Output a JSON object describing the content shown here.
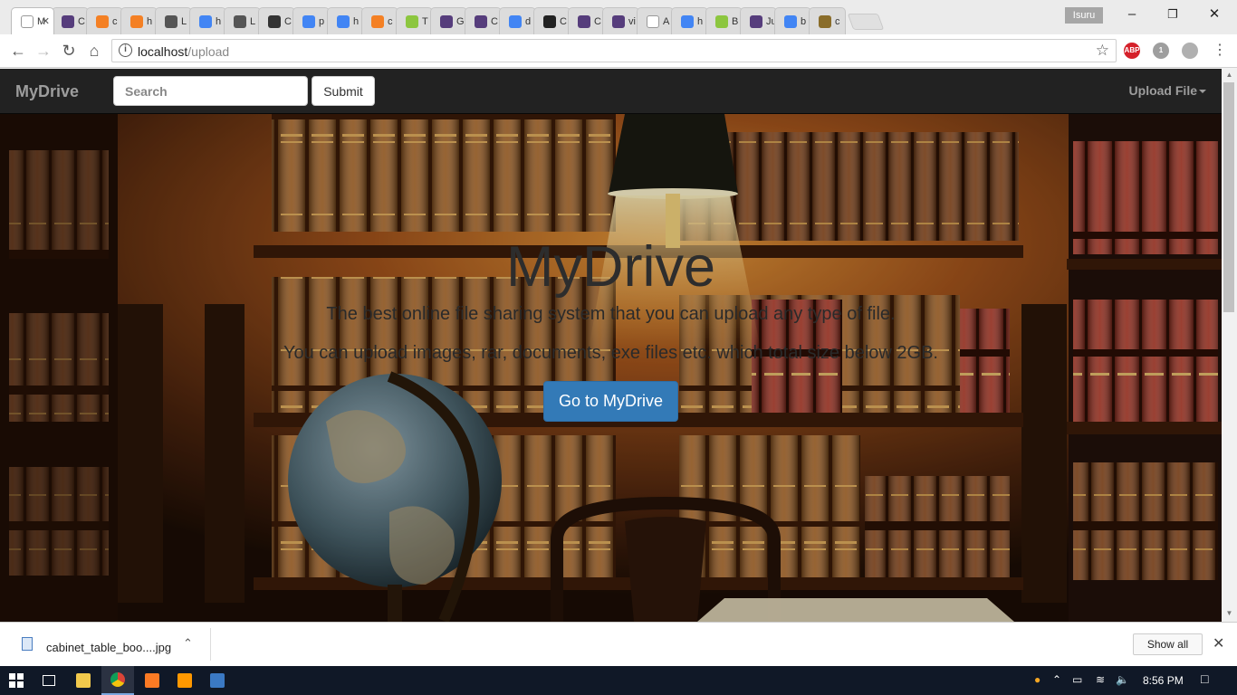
{
  "browser": {
    "tabs": [
      {
        "label": "M",
        "icon": "doc-icon",
        "color": "#ffffff",
        "active": true
      },
      {
        "label": "C",
        "icon": "bootstrap-icon",
        "color": "#563d7c"
      },
      {
        "label": "c",
        "icon": "stackoverflow-icon",
        "color": "#f48024"
      },
      {
        "label": "h",
        "icon": "stackoverflow-icon",
        "color": "#f48024"
      },
      {
        "label": "L",
        "icon": "dark-circle-icon",
        "color": "#555555"
      },
      {
        "label": "h",
        "icon": "google-icon",
        "color": "#4285f4"
      },
      {
        "label": "L",
        "icon": "dark-circle-icon",
        "color": "#555555"
      },
      {
        "label": "C",
        "icon": "play-icon",
        "color": "#333333"
      },
      {
        "label": "p",
        "icon": "google-icon",
        "color": "#4285f4"
      },
      {
        "label": "h",
        "icon": "google-icon",
        "color": "#4285f4"
      },
      {
        "label": "c",
        "icon": "stackoverflow-icon",
        "color": "#f48024"
      },
      {
        "label": "T",
        "icon": "w3schools-icon",
        "color": "#8cc63f"
      },
      {
        "label": "G",
        "icon": "bootstrap-icon",
        "color": "#563d7c"
      },
      {
        "label": "C",
        "icon": "bootstrap-icon",
        "color": "#563d7c"
      },
      {
        "label": "d",
        "icon": "google-icon",
        "color": "#4285f4"
      },
      {
        "label": "C",
        "icon": "w-icon",
        "color": "#222222"
      },
      {
        "label": "C",
        "icon": "bootstrap-icon",
        "color": "#563d7c"
      },
      {
        "label": "vi",
        "icon": "bootstrap-icon",
        "color": "#563d7c"
      },
      {
        "label": "A",
        "icon": "doc-icon",
        "color": "#ffffff"
      },
      {
        "label": "h",
        "icon": "google-icon",
        "color": "#4285f4"
      },
      {
        "label": "B",
        "icon": "w3schools-icon",
        "color": "#8cc63f"
      },
      {
        "label": "Ju",
        "icon": "bootstrap-icon",
        "color": "#563d7c"
      },
      {
        "label": "b",
        "icon": "google-icon",
        "color": "#4285f4"
      },
      {
        "label": "c",
        "icon": "grid-icon",
        "color": "#8a6d2a"
      }
    ],
    "profile_name": "Isuru",
    "url_host": "localhost",
    "url_path": "/upload",
    "extensions": [
      {
        "label": "ABP",
        "icon": "adblock-icon",
        "color": "#d5202a"
      },
      {
        "label": "1",
        "icon": "ghost-icon",
        "color": "#9e9e9e"
      },
      {
        "label": "",
        "icon": "puzzle-icon",
        "color": "#b0b0b0"
      }
    ]
  },
  "page": {
    "brand": "MyDrive",
    "search_placeholder": "Search",
    "submit_label": "Submit",
    "upload_menu": "Upload File",
    "hero_title": "MyDrive",
    "hero_line1": "The best online file sharing system that you can upload any type of file.",
    "hero_line2": "You can upload images, rar, documents, exe files etc. which total size below 2GB.",
    "cta_label": "Go to MyDrive"
  },
  "downloads": {
    "file_name": "cabinet_table_boo....jpg",
    "show_all": "Show all"
  },
  "taskbar": {
    "time": "8:56 PM",
    "apps": [
      {
        "icon": "task-view-icon"
      },
      {
        "icon": "file-explorer-icon",
        "color": "#f2c94c"
      },
      {
        "icon": "chrome-icon",
        "active": true
      },
      {
        "icon": "xampp-icon",
        "color": "#fb7a24"
      },
      {
        "icon": "sublime-icon",
        "color": "#ff9800"
      },
      {
        "icon": "editor-icon",
        "color": "#3b79c4"
      }
    ]
  }
}
